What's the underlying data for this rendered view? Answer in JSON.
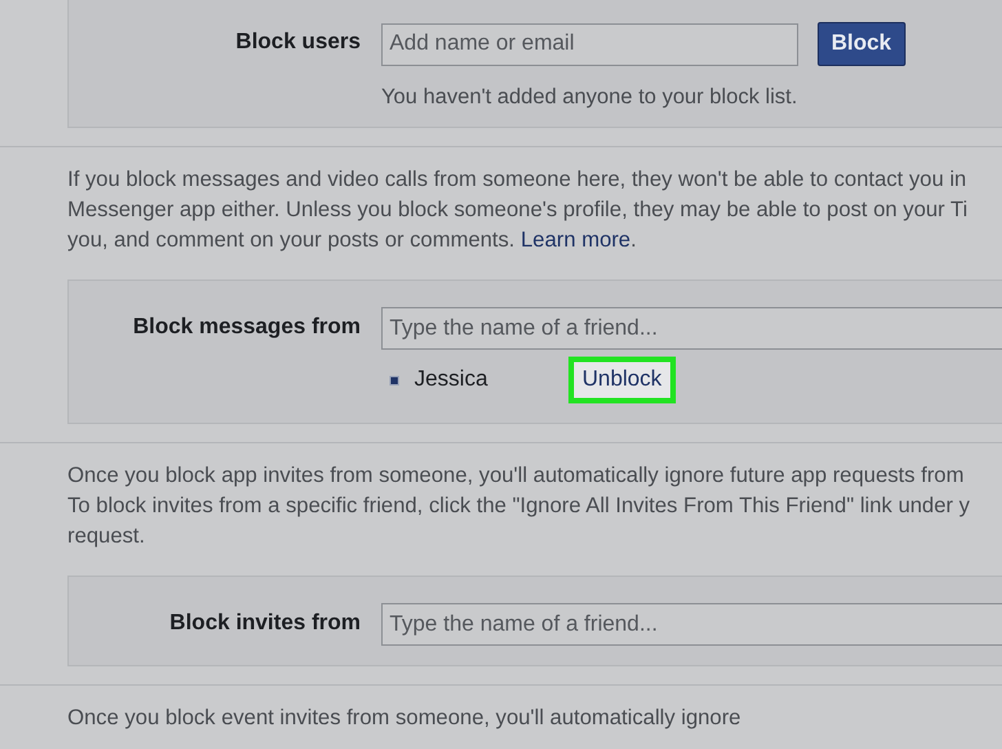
{
  "block_users": {
    "label": "Block users",
    "input": {
      "placeholder": "Add name or email"
    },
    "button": "Block",
    "note": "You haven't added anyone to your block list."
  },
  "sections": [
    {
      "description": {
        "lines": [
          "If you block messages and video calls from someone here, they won't be able to contact you in",
          "Messenger app either. Unless you block someone's profile, they may be able to post on your Ti",
          "you, and comment on your posts or comments. "
        ],
        "link": "Learn more",
        "after_link": "."
      },
      "form": {
        "label": "Block messages from",
        "input": {
          "placeholder": "Type the name of a friend..."
        },
        "blocked": [
          {
            "name": "Jessica",
            "action": "Unblock",
            "highlighted": true
          }
        ]
      }
    },
    {
      "description": {
        "lines": [
          "Once you block app invites from someone, you'll automatically ignore future app requests from",
          "To block invites from a specific friend, click the \"Ignore All Invites From This Friend\" link under y",
          "request."
        ]
      },
      "form": {
        "label": "Block invites from",
        "input": {
          "placeholder": "Type the name of a friend..."
        }
      }
    },
    {
      "description": {
        "lines": [
          "Once you block event invites from someone, you'll automatically ignore"
        ]
      }
    }
  ]
}
